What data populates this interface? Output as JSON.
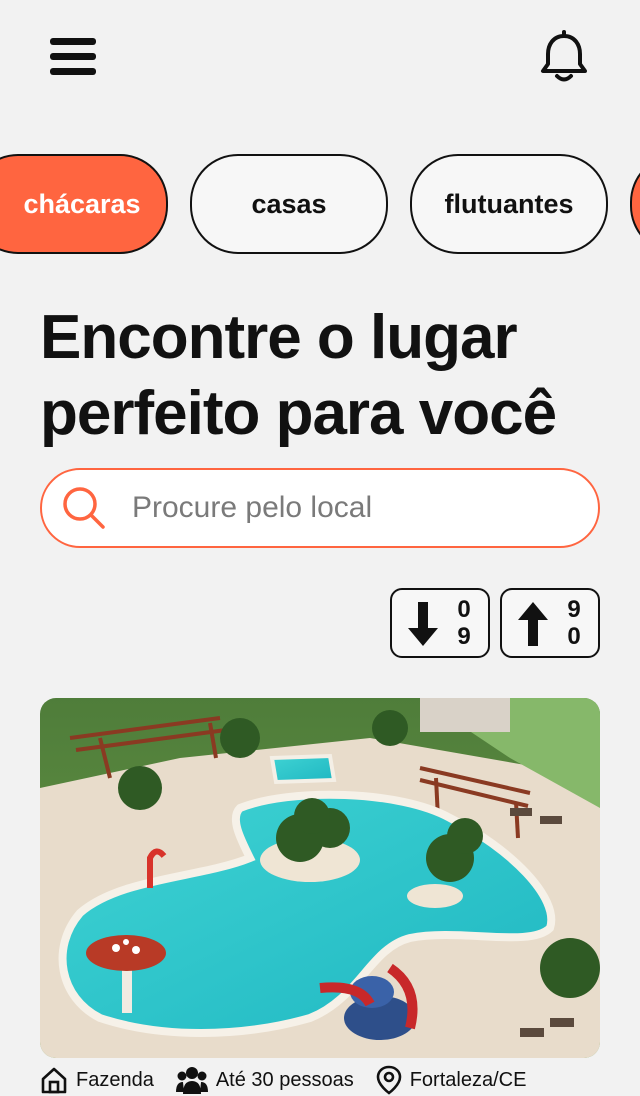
{
  "header": {
    "menu_icon": "hamburger-menu-icon",
    "notification_icon": "bell-icon"
  },
  "categories": [
    {
      "label": "chácaras",
      "active": true
    },
    {
      "label": "casas",
      "active": false
    },
    {
      "label": "flutuantes",
      "active": false
    },
    {
      "label": "",
      "active": true
    }
  ],
  "headline": {
    "line1": "Encontre o lugar",
    "line2": "perfeito para você"
  },
  "search": {
    "placeholder": "Procure pelo local",
    "value": "",
    "icon": "search-icon"
  },
  "sort": {
    "ascending": {
      "icon": "arrow-down-icon",
      "top": "0",
      "bottom": "9"
    },
    "descending": {
      "icon": "arrow-up-icon",
      "top": "9",
      "bottom": "0"
    }
  },
  "listing": {
    "image": "aerial view of resort pool with palm trees",
    "type": "Fazenda",
    "capacity": "Até 30 pessoas",
    "location": "Fortaleza/CE",
    "type_icon": "home-icon",
    "capacity_icon": "people-icon",
    "location_icon": "map-pin-icon"
  },
  "colors": {
    "accent": "#ff6540",
    "background": "#f2f2f2",
    "text": "#111111"
  }
}
